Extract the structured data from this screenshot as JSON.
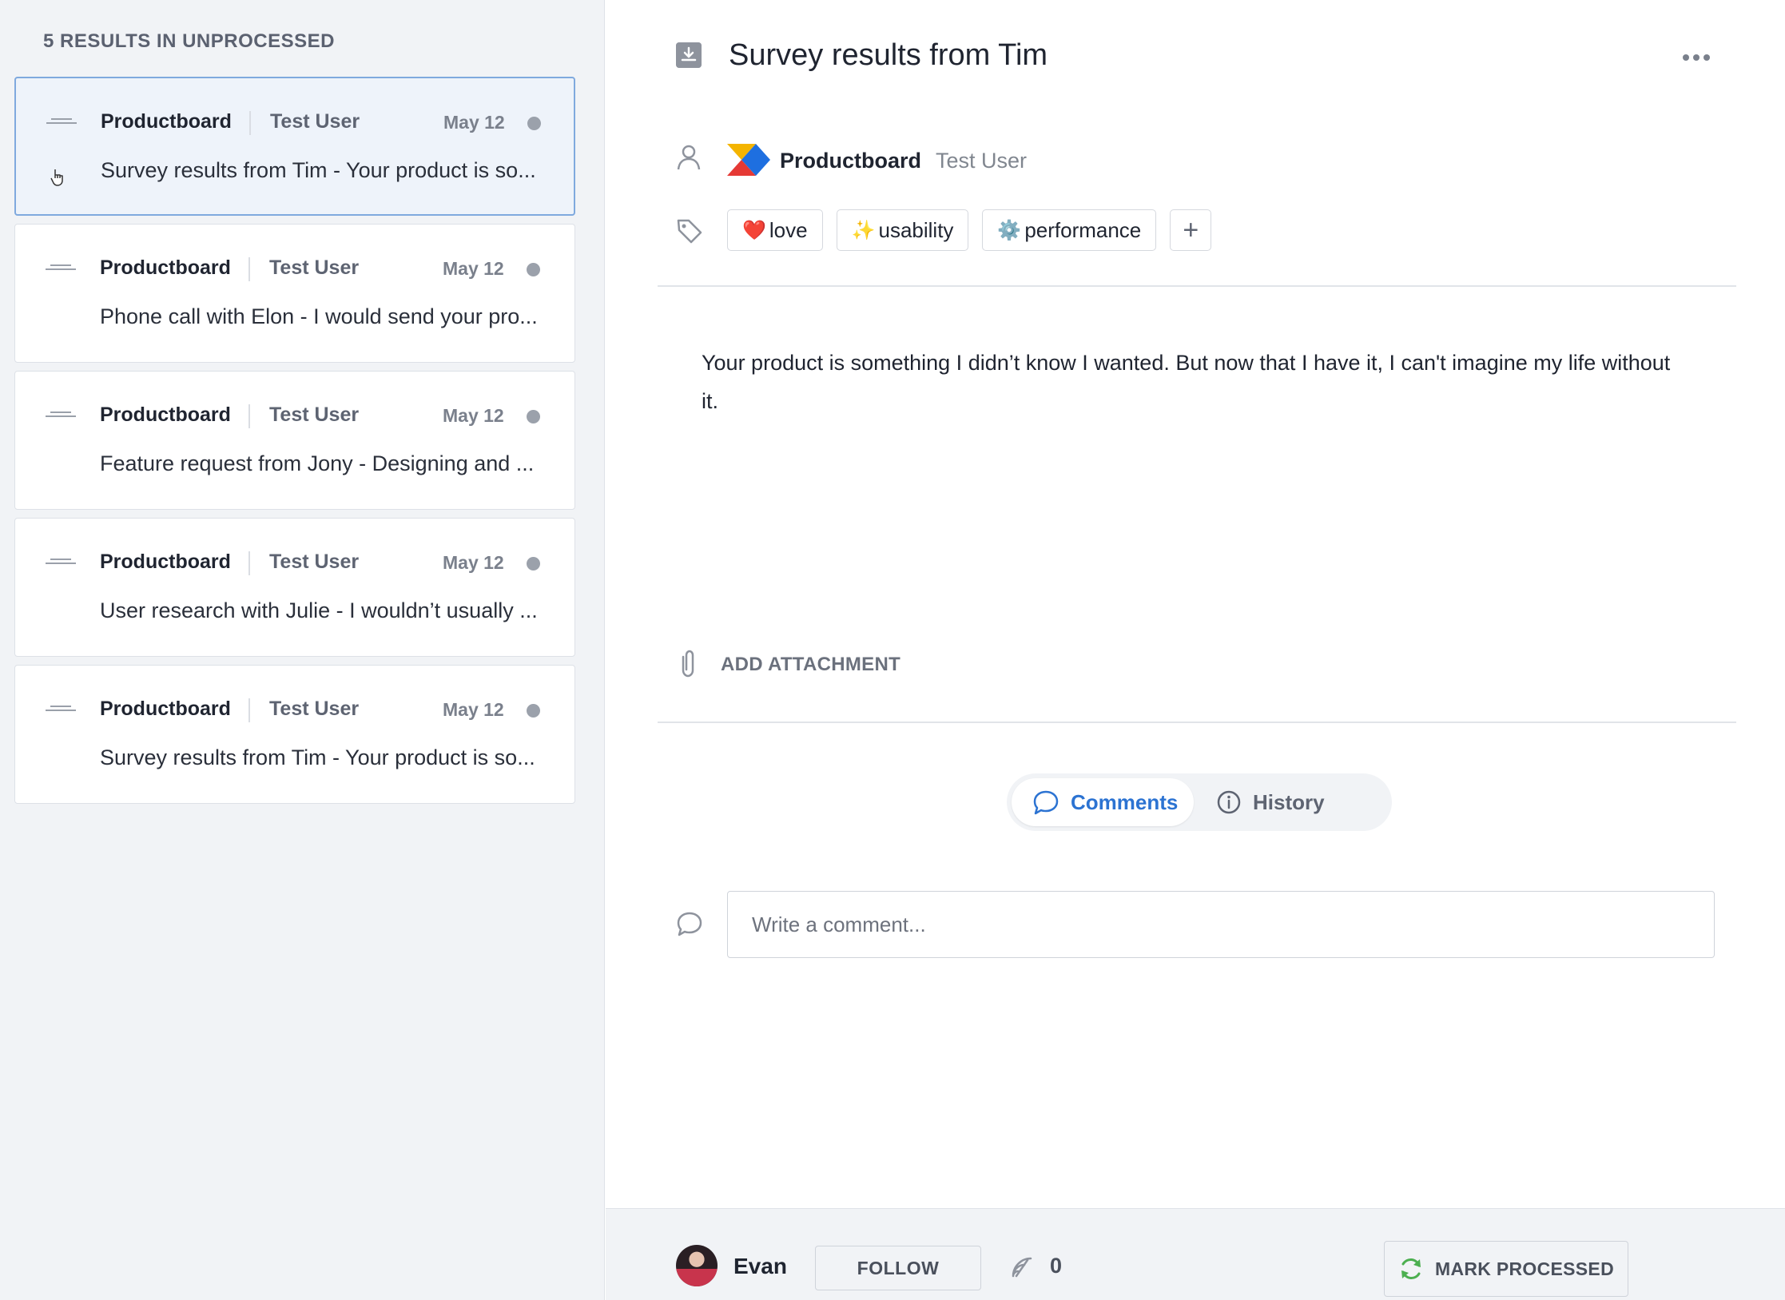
{
  "list": {
    "header": "5 RESULTS IN UNPROCESSED",
    "items": [
      {
        "source": "Productboard",
        "user": "Test User",
        "date": "May 12",
        "snippet": "Survey results from Tim - Your product is so...",
        "selected": true
      },
      {
        "source": "Productboard",
        "user": "Test User",
        "date": "May 12",
        "snippet": "Phone call with Elon - I would send your pro..."
      },
      {
        "source": "Productboard",
        "user": "Test User",
        "date": "May 12",
        "snippet": "Feature request from Jony - Designing and ..."
      },
      {
        "source": "Productboard",
        "user": "Test User",
        "date": "May 12",
        "snippet": "User research with Julie - I wouldn’t usually ..."
      },
      {
        "source": "Productboard",
        "user": "Test User",
        "date": "May 12",
        "snippet": "Survey results from Tim - Your product is so..."
      }
    ]
  },
  "detail": {
    "title": "Survey results from Tim",
    "source": "Productboard",
    "user": "Test User",
    "tags": [
      {
        "emoji": "❤️",
        "label": "love"
      },
      {
        "emoji": "✨",
        "label": "usability"
      },
      {
        "emoji": "⚙️",
        "label": "performance"
      }
    ],
    "add_tag_label": "+",
    "body": "Your product is something I didn’t know I wanted. But now that I have it, I can't imagine my life without it.",
    "add_attachment_label": "ADD ATTACHMENT",
    "tabs": {
      "comments": "Comments",
      "history": "History"
    },
    "comment_placeholder": "Write a comment..."
  },
  "footer": {
    "user_name": "Evan",
    "follow_label": "FOLLOW",
    "follower_count": "0",
    "mark_processed_label": "MARK PROCESSED"
  },
  "colors": {
    "accent": "#2c73d2",
    "selected_card_border": "#7fa9de",
    "refresh_green": "#4caf50"
  }
}
